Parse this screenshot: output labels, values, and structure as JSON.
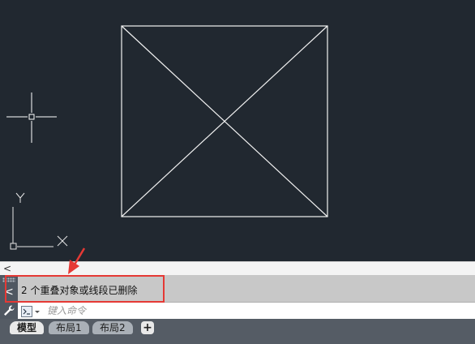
{
  "drawing": {
    "axis_x_label": "X",
    "axis_y_label": "Y"
  },
  "history": {
    "collapse_glyph": "<"
  },
  "command_line": {
    "toggle_glyph": "<",
    "last_message": "2 个重叠对象或线段已删除",
    "input_placeholder": "键入命令",
    "input_value": ""
  },
  "tabs": {
    "items": [
      {
        "label": "模型",
        "active": true
      },
      {
        "label": "布局1",
        "active": false
      },
      {
        "label": "布局2",
        "active": false
      }
    ],
    "add_label": "+"
  },
  "colors": {
    "canvas_bg": "#212830",
    "drawing_line": "#ffffff",
    "annotation": "#e53935",
    "command_bg": "#c8c8c8",
    "tab_bar_bg": "#555c65"
  },
  "icons": {
    "crosshair": "crosshair-cursor-icon",
    "ucs": "ucs-icon",
    "wrench": "wrench-icon",
    "prompt": "command-prompt-icon",
    "annotation_arrow": "arrow-icon"
  }
}
